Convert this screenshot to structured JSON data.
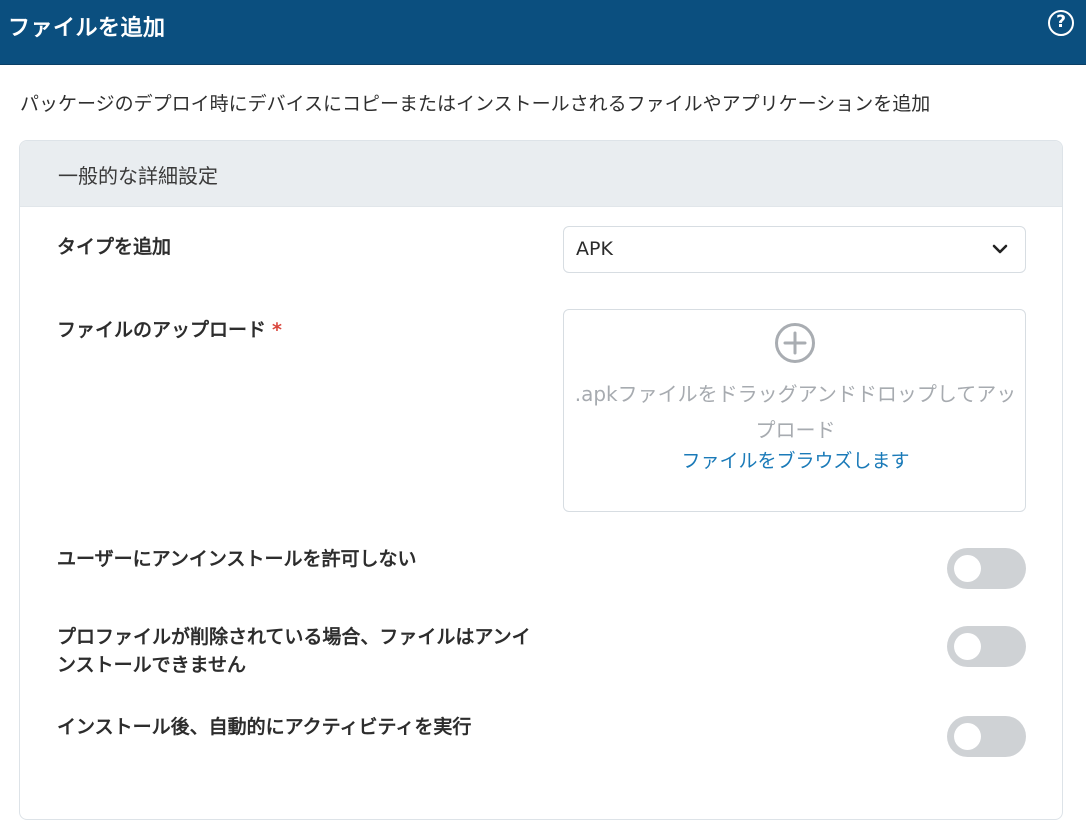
{
  "header": {
    "title": "ファイルを追加",
    "help_icon": "help-circle-icon",
    "help_glyph": "?"
  },
  "intro": "パッケージのデプロイ時にデバイスにコピーまたはインストールされるファイルやアプリケーションを追加",
  "section": {
    "title": "一般的な詳細設定"
  },
  "type_field": {
    "label": "タイプを追加",
    "value": "APK",
    "icon": "chevron-down-icon"
  },
  "upload_field": {
    "label": "ファイルのアップロード",
    "required_mark": "*",
    "icon": "plus-circle-icon",
    "dropzone_text": ".apkファイルをドラッグアンドドロップしてアップロード",
    "browse_link": "ファイルをブラウズします"
  },
  "toggles": [
    {
      "label": "ユーザーにアンインストールを許可しない",
      "on": false
    },
    {
      "label": "プロファイルが削除されている場合、ファイルはアンインストールできません",
      "on": false
    },
    {
      "label": "インストール後、自動的にアクティビティを実行",
      "on": false
    }
  ],
  "colors": {
    "header_bg": "#0b4f7f",
    "link": "#1a7ab8",
    "required": "#d9453c",
    "toggle_off": "#cfd2d5"
  }
}
